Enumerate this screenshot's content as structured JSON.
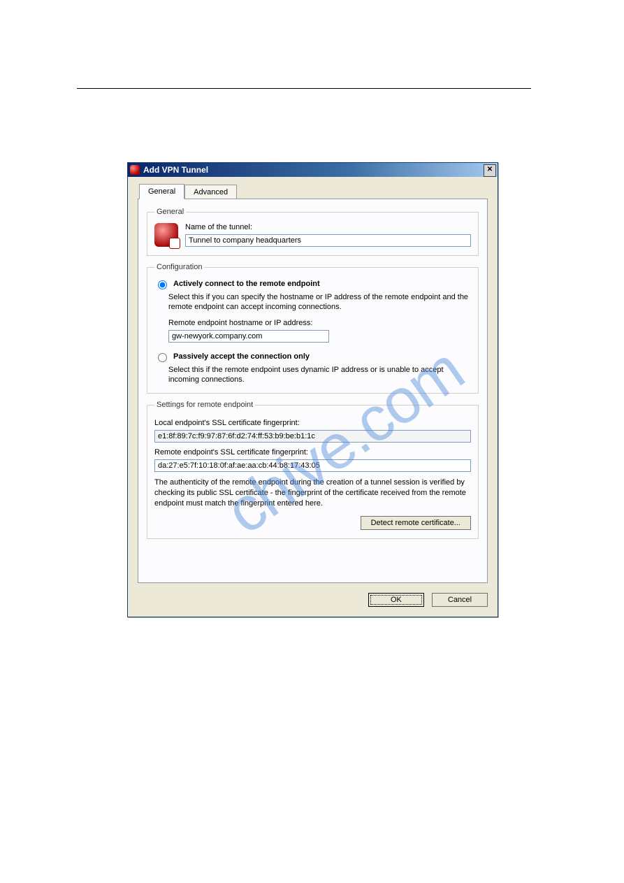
{
  "watermark": "chive.com",
  "dialog": {
    "title": "Add VPN Tunnel",
    "tabs": {
      "general": "General",
      "advanced": "Advanced"
    },
    "general_group": {
      "legend": "General",
      "name_label": "Name of the tunnel:",
      "name_value": "Tunnel to company headquarters"
    },
    "config_group": {
      "legend": "Configuration",
      "active_label": "Actively connect to the remote endpoint",
      "active_help": "Select this if you can specify the hostname or IP address of the remote endpoint and the remote endpoint can accept incoming connections.",
      "remote_label": "Remote endpoint hostname or IP address:",
      "remote_value": "gw-newyork.company.com",
      "passive_label": "Passively accept the connection only",
      "passive_help": "Select this if the remote endpoint uses dynamic IP address or is unable to accept incoming connections."
    },
    "settings_group": {
      "legend": "Settings for remote endpoint",
      "local_fp_label": "Local endpoint's SSL certificate fingerprint:",
      "local_fp_value": "e1:8f:89:7c:f9:97:87:6f:d2:74:ff:53:b9:be:b1:1c",
      "remote_fp_label": "Remote endpoint's SSL certificate fingerprint:",
      "remote_fp_value": "da:27:e5:7f:10:18:0f:af:ae:aa:cb:44:b8:17:43:05",
      "auth_note": "The authenticity of the remote endpoint during the creation of a tunnel session is verified by checking its public SSL certificate - the fingerprint of the certificate received from the remote endpoint must match the fingerprint entered here.",
      "detect_button": "Detect remote certificate..."
    },
    "buttons": {
      "ok": "OK",
      "cancel": "Cancel"
    }
  }
}
